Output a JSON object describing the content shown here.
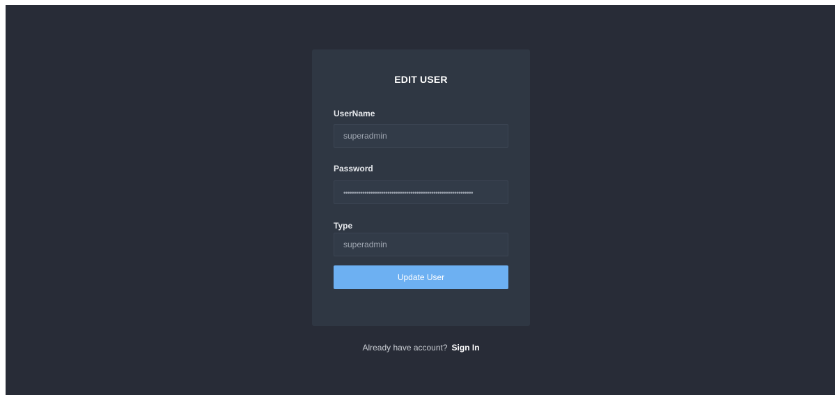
{
  "form": {
    "title": "EDIT USER",
    "username": {
      "label": "UserName",
      "value": "superadmin"
    },
    "password": {
      "label": "Password",
      "value": "••••••••••••••••••••••••••••••••••••••••••••••••••••••••••••••"
    },
    "type": {
      "label": "Type",
      "value": "superadmin"
    },
    "submit_label": "Update User"
  },
  "footer": {
    "prompt": "Already have account?",
    "link_label": "Sign In"
  },
  "colors": {
    "background": "#282c37",
    "card": "#2f3743",
    "input": "#323b48",
    "accent": "#6db0f2"
  }
}
